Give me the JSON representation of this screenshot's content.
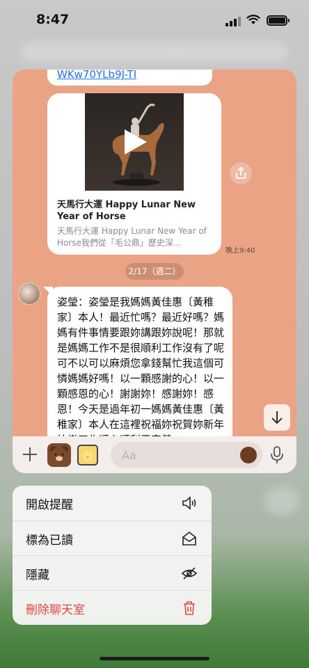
{
  "status_bar": {
    "time": "8:47"
  },
  "chat": {
    "link_text": "WKw70YLb9J-TI",
    "media": {
      "title": "天馬行大運 Happy Lunar New Year of Horse",
      "description": "天馬行大運 Happy Lunar New Year of Horse我們從「毛公鼎」歷史深…",
      "time": "晚上9:40"
    },
    "date_separator": "2/17（週二）",
    "message": "姿瑩：姿瑩是我媽媽黃佳惠〔黃稚家〕本人！最近忙嗎？最近好嗎？媽媽有件事情要跟妳講跟妳說呢！那就是媽媽工作不是很順利工作沒有了呢可不以可以麻煩您拿錢幫忙我這個可憐媽媽好嗎！以一顆感謝的心！以一顆感恩的心！謝謝妳！感謝妳！感恩！今天是過年初一媽媽黃佳惠〔黃稚家〕本人在這裡祝福妳祝賀妳新年快樂工作順心順利平安健",
    "input_placeholder": "Aa"
  },
  "menu": {
    "items": [
      {
        "label": "開啟提醒",
        "icon": "speaker-icon",
        "danger": false
      },
      {
        "label": "標為已讀",
        "icon": "envelope-open-icon",
        "danger": false
      },
      {
        "label": "隱藏",
        "icon": "eye-off-icon",
        "danger": false
      },
      {
        "label": "刪除聊天室",
        "icon": "trash-icon",
        "danger": true
      }
    ]
  },
  "colors": {
    "chat_background": "#eaa385",
    "danger": "#e0463e",
    "link": "#1e73e8"
  }
}
